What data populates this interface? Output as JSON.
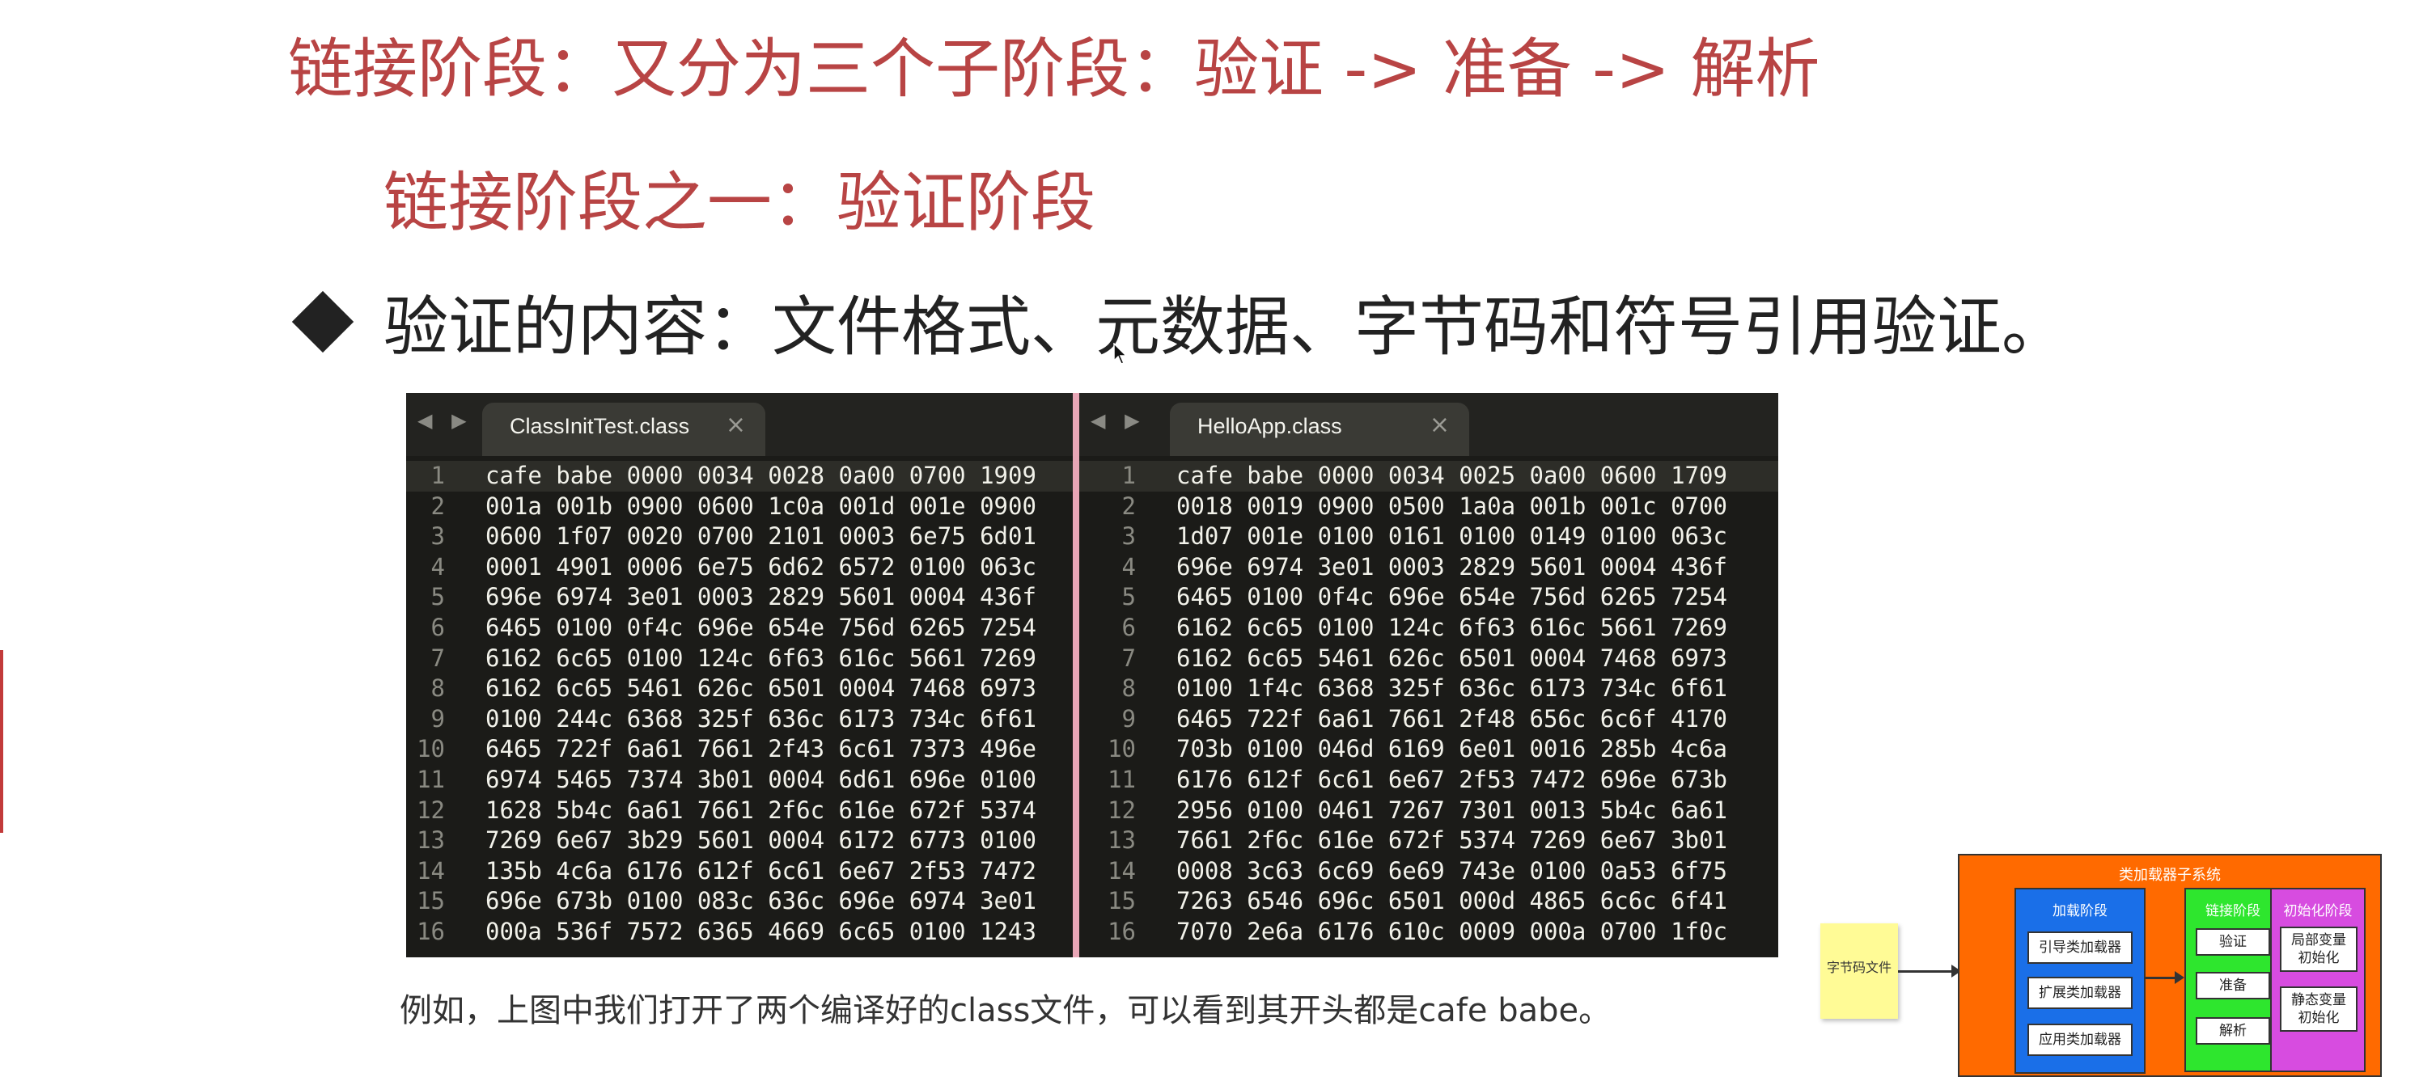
{
  "slide": {
    "title": "链接阶段：又分为三个子阶段：验证 -> 准备 -> 解析",
    "subtitle": "链接阶段之一：验证阶段",
    "bullet": "验证的内容：文件格式、元数据、字节码和符号引用验证。"
  },
  "editors": [
    {
      "tab": "ClassInitTest.class",
      "lines": [
        {
          "n": "1",
          "code": "cafe babe 0000 0034 0028 0a00 0700 1909"
        },
        {
          "n": "2",
          "code": "001a 001b 0900 0600 1c0a 001d 001e 0900"
        },
        {
          "n": "3",
          "code": "0600 1f07 0020 0700 2101 0003 6e75 6d01"
        },
        {
          "n": "4",
          "code": "0001 4901 0006 6e75 6d62 6572 0100 063c"
        },
        {
          "n": "5",
          "code": "696e 6974 3e01 0003 2829 5601 0004 436f"
        },
        {
          "n": "6",
          "code": "6465 0100 0f4c 696e 654e 756d 6265 7254"
        },
        {
          "n": "7",
          "code": "6162 6c65 0100 124c 6f63 616c 5661 7269"
        },
        {
          "n": "8",
          "code": "6162 6c65 5461 626c 6501 0004 7468 6973"
        },
        {
          "n": "9",
          "code": "0100 244c 6368 325f 636c 6173 734c 6f61"
        },
        {
          "n": "10",
          "code": "6465 722f 6a61 7661 2f43 6c61 7373 496e"
        },
        {
          "n": "11",
          "code": "6974 5465 7374 3b01 0004 6d61 696e 0100"
        },
        {
          "n": "12",
          "code": "1628 5b4c 6a61 7661 2f6c 616e 672f 5374"
        },
        {
          "n": "13",
          "code": "7269 6e67 3b29 5601 0004 6172 6773 0100"
        },
        {
          "n": "14",
          "code": "135b 4c6a 6176 612f 6c61 6e67 2f53 7472"
        },
        {
          "n": "15",
          "code": "696e 673b 0100 083c 636c 696e 6974 3e01"
        },
        {
          "n": "16",
          "code": "000a 536f 7572 6365 4669 6c65 0100 1243"
        }
      ]
    },
    {
      "tab": "HelloApp.class",
      "lines": [
        {
          "n": "1",
          "code": "cafe babe 0000 0034 0025 0a00 0600 1709"
        },
        {
          "n": "2",
          "code": "0018 0019 0900 0500 1a0a 001b 001c 0700"
        },
        {
          "n": "3",
          "code": "1d07 001e 0100 0161 0100 0149 0100 063c"
        },
        {
          "n": "4",
          "code": "696e 6974 3e01 0003 2829 5601 0004 436f"
        },
        {
          "n": "5",
          "code": "6465 0100 0f4c 696e 654e 756d 6265 7254"
        },
        {
          "n": "6",
          "code": "6162 6c65 0100 124c 6f63 616c 5661 7269"
        },
        {
          "n": "7",
          "code": "6162 6c65 5461 626c 6501 0004 7468 6973"
        },
        {
          "n": "8",
          "code": "0100 1f4c 6368 325f 636c 6173 734c 6f61"
        },
        {
          "n": "9",
          "code": "6465 722f 6a61 7661 2f48 656c 6c6f 4170"
        },
        {
          "n": "10",
          "code": "703b 0100 046d 6169 6e01 0016 285b 4c6a"
        },
        {
          "n": "11",
          "code": "6176 612f 6c61 6e67 2f53 7472 696e 673b"
        },
        {
          "n": "12",
          "code": "2956 0100 0461 7267 7301 0013 5b4c 6a61"
        },
        {
          "n": "13",
          "code": "7661 2f6c 616e 672f 5374 7269 6e67 3b01"
        },
        {
          "n": "14",
          "code": "0008 3c63 6c69 6e69 743e 0100 0a53 6f75"
        },
        {
          "n": "15",
          "code": "7263 6546 696c 6501 000d 4865 6c6c 6f41"
        },
        {
          "n": "16",
          "code": "7070 2e6a 6176 610c 0009 000a 0700 1f0c"
        }
      ]
    }
  ],
  "caption": "例如，上图中我们打开了两个编译好的class文件，可以看到其开头都是cafe babe。",
  "diagram": {
    "note": "字节码文件",
    "system_title": "类加载器子系统",
    "loading": {
      "title": "加载阶段",
      "items": [
        "引导类加载器",
        "扩展类加载器",
        "应用类加载器"
      ]
    },
    "linking": {
      "title": "链接阶段",
      "items": [
        "验证",
        "准备",
        "解析"
      ]
    },
    "init": {
      "title": "初始化阶段",
      "items": [
        "局部变量初始化",
        "静态变量初始化"
      ]
    }
  },
  "colors": {
    "title_red": "#b84444",
    "editor_bg": "#1b1b18",
    "divider_pink": "#e8a6b6",
    "system_orange": "#ff6a00",
    "loading_blue": "#1a6fe8",
    "linking_green": "#2ee62e",
    "init_purple": "#d74ce0",
    "note_yellow": "#fffb96"
  }
}
